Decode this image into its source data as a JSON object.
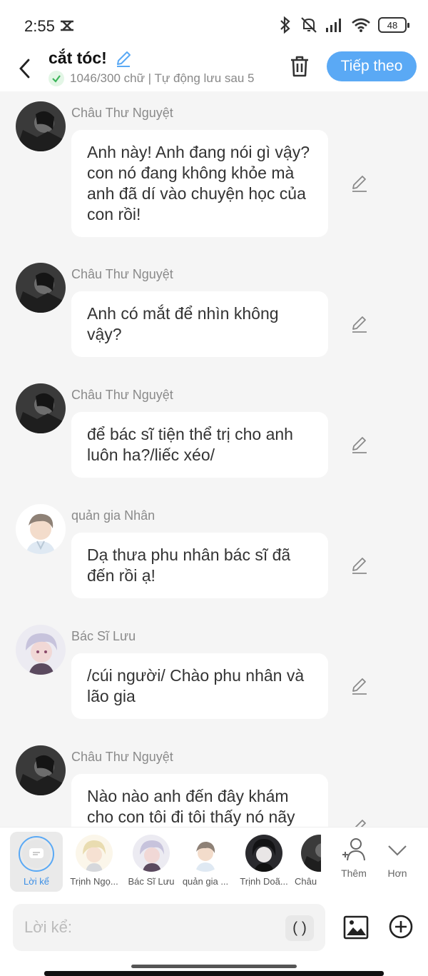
{
  "status_bar": {
    "time": "2:55",
    "battery": "48"
  },
  "header": {
    "title": "cắt tóc!",
    "subline": "1046/300 chữ | Tự động lưu sau 5",
    "next_label": "Tiếp theo"
  },
  "messages": [
    {
      "sender": "Châu Thư Nguyệt",
      "text": "Anh này! Anh đang nói gì vậy? con nó đang không khỏe mà anh đã dí vào chuyện học của con rồi!",
      "avatar": "dark"
    },
    {
      "sender": "Châu Thư Nguyệt",
      "text": "Anh có mắt để nhìn không vậy?",
      "avatar": "dark"
    },
    {
      "sender": "Châu Thư Nguyệt",
      "text": "để bác sĩ tiện thể trị cho anh luôn ha?/liếc xéo/",
      "avatar": "dark"
    },
    {
      "sender": "quản gia Nhân",
      "text": "Dạ thưa phu nhân bác sĩ đã đến rồi ạ!",
      "avatar": "butler"
    },
    {
      "sender": "Bác Sĩ Lưu",
      "text": "/cúi người/ Chào phu nhân và lão gia",
      "avatar": "doctor"
    },
    {
      "sender": "Châu Thư Nguyệt",
      "text": "Nào nào anh đến đây khám cho con tôi đi tôi thấy nó nãy",
      "avatar": "dark"
    }
  ],
  "characters": [
    {
      "name": "Lời kể",
      "kind": "narration"
    },
    {
      "name": "Trịnh Ngọ...",
      "kind": "blond"
    },
    {
      "name": "Bác Sĩ Lưu",
      "kind": "doctor"
    },
    {
      "name": "quản gia ...",
      "kind": "butler"
    },
    {
      "name": "Trịnh Doã...",
      "kind": "darkhair"
    },
    {
      "name": "Châu",
      "kind": "dark"
    }
  ],
  "tools": {
    "add_label": "Thêm",
    "more_label": "Hơn"
  },
  "input": {
    "placeholder": "Lời kể:",
    "paren_label": "( )"
  }
}
